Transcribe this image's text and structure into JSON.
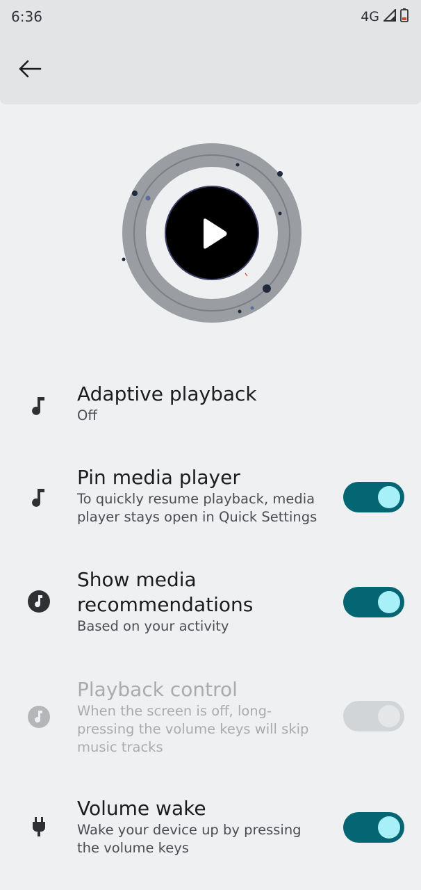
{
  "status_bar": {
    "time": "6:36",
    "network": "4G"
  },
  "app_bar": {
    "back_icon": "arrow-left-icon"
  },
  "media_output_animation": {
    "icon": "play-icon"
  },
  "settings": [
    {
      "icon": "music-note-icon",
      "title": "Adaptive playback",
      "subtitle": "Off",
      "has_toggle": false
    },
    {
      "icon": "music-note-icon",
      "title": "Pin media player",
      "subtitle": "To quickly resume playback, media player stays open in Quick Settings",
      "has_toggle": true,
      "toggle_on": true,
      "enabled": true
    },
    {
      "icon": "music-circle-icon",
      "title": "Show media recommendations",
      "subtitle": "Based on your activity",
      "has_toggle": true,
      "toggle_on": true,
      "enabled": true
    },
    {
      "icon": "music-circle-icon",
      "title": "Playback control",
      "subtitle": "When the screen is off, long-pressing the volume keys will skip music tracks",
      "has_toggle": true,
      "toggle_on": true,
      "enabled": false
    },
    {
      "icon": "power-plug-icon",
      "title": "Volume wake",
      "subtitle": "Wake your device up by pressing the volume keys",
      "has_toggle": true,
      "toggle_on": true,
      "enabled": true
    }
  ],
  "colors": {
    "accent": "#056673",
    "knob": "#a8f0f7",
    "background": "#eef0f2"
  }
}
